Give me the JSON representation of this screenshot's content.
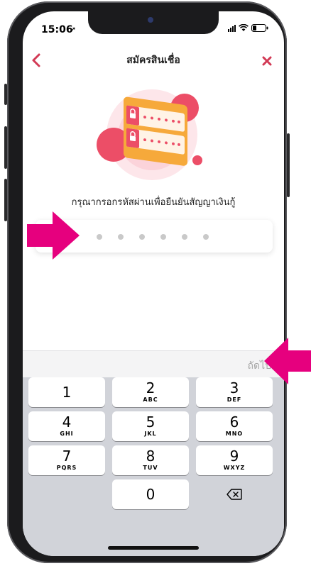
{
  "status": {
    "time": "15:06",
    "location_icon": "location-arrow-icon",
    "battery_icon": "battery-icon"
  },
  "nav": {
    "back_icon": "chevron-left-icon",
    "title": "สมัครสินเชื่อ",
    "close_icon": "close-icon"
  },
  "hero": {
    "icon": "password-card-lock-icon"
  },
  "prompt": "กรุณากรอกรหัสผ่านเพื่อยืนยันสัญญาเงินกู้",
  "pin": {
    "length": 6,
    "filled": 0
  },
  "accessory": {
    "next_label": "ถัดไป"
  },
  "keypad": {
    "keys": [
      {
        "num": "1",
        "letters": ""
      },
      {
        "num": "2",
        "letters": "ABC"
      },
      {
        "num": "3",
        "letters": "DEF"
      },
      {
        "num": "4",
        "letters": "GHI"
      },
      {
        "num": "5",
        "letters": "JKL"
      },
      {
        "num": "6",
        "letters": "MNO"
      },
      {
        "num": "7",
        "letters": "PQRS"
      },
      {
        "num": "8",
        "letters": "TUV"
      },
      {
        "num": "9",
        "letters": "WXYZ"
      },
      {
        "num": "0",
        "letters": ""
      }
    ],
    "delete_icon": "backspace-icon"
  },
  "colors": {
    "accent": "#d23a55",
    "annotation_arrow": "#e6007e",
    "keyboard_bg": "#d1d3d9"
  }
}
